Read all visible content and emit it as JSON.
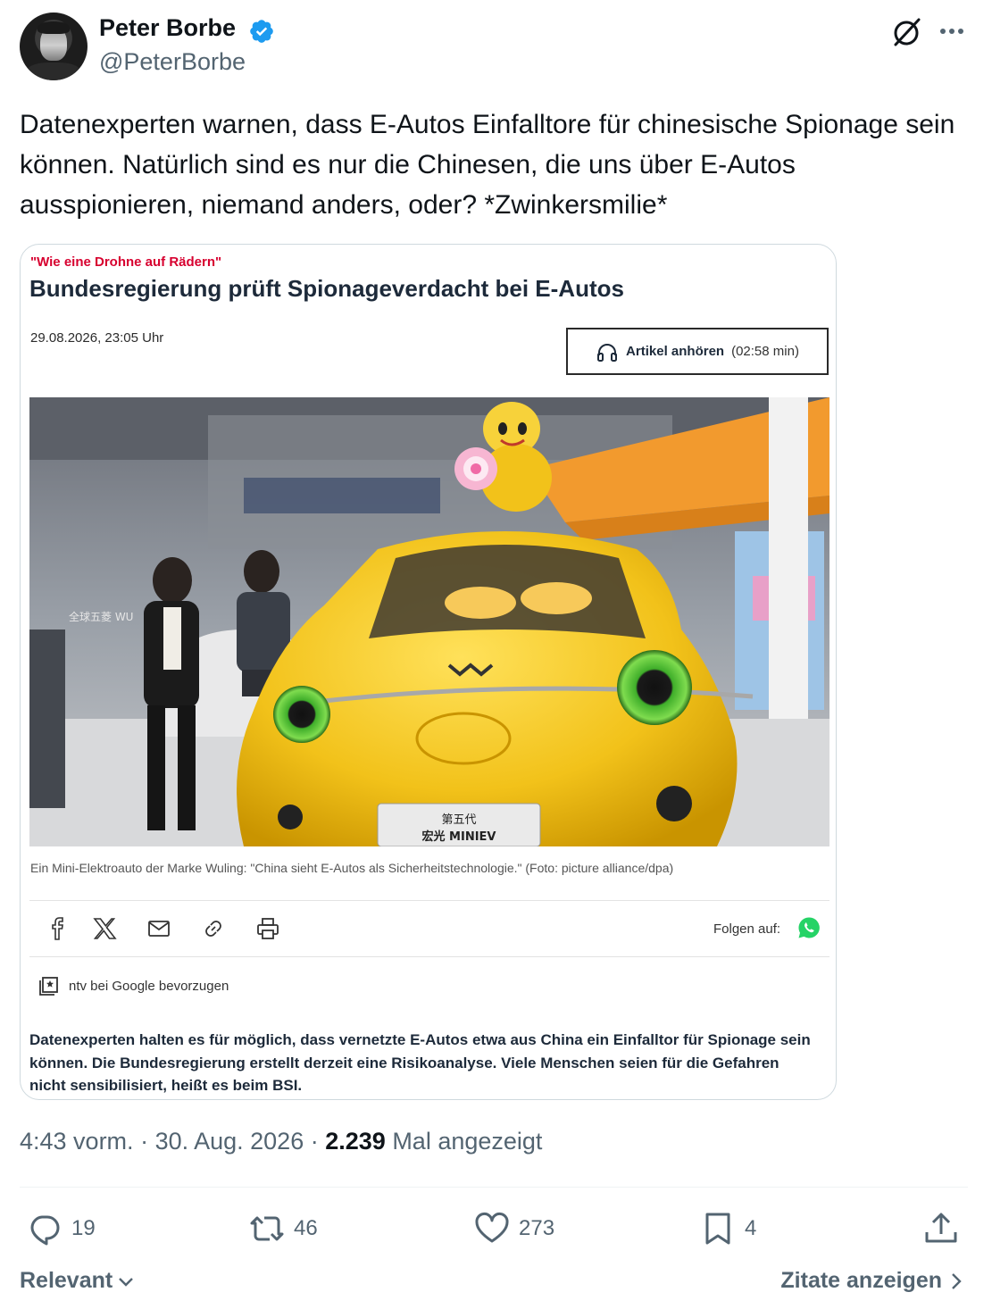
{
  "author": {
    "name": "Peter Borbe",
    "handle": "@PeterBorbe",
    "verified": true
  },
  "tweet": {
    "text": "Datenexperten warnen, dass E-Autos Einfalltore für chinesische Spionage sein können. Natürlich sind es nur die Chinesen, die uns über E-Autos ausspionieren, niemand anders, oder? *Zwinkersmilie*"
  },
  "article": {
    "kicker": "\"Wie eine Drohne auf Rädern\"",
    "headline": "Bundesregierung prüft Spionageverdacht bei E-Autos",
    "date": "29.08.2026, 23:05 Uhr",
    "listen_label": "Artikel anhören",
    "listen_duration": "(02:58 min)",
    "caption": "Ein Mini-Elektroauto der Marke Wuling: \"China sieht E-Autos als Sicherheitstechnologie.\" (Foto: picture alliance/dpa)",
    "follow_label": "Folgen auf:",
    "google_pref": "ntv bei Google bevorzugen",
    "teaser": "Datenexperten halten es für möglich, dass vernetzte E-Autos etwa aus China ein Einfalltor für Spionage sein können. Die Bundesregierung erstellt derzeit eine Risikoanalyse. Viele Menschen seien für die Gefahren nicht sensibilisiert, heißt es beim BSI.",
    "photo_plate_top": "第五代",
    "photo_plate_bottom": "宏光 MINIEV",
    "photo_sign": "全球五菱 WU"
  },
  "meta": {
    "time": "4:43 vorm.",
    "date": "30. Aug. 2026",
    "views": "2.239",
    "views_label": "Mal angezeigt"
  },
  "actions": {
    "replies": "19",
    "reposts": "46",
    "likes": "273",
    "bookmarks": "4"
  },
  "footer": {
    "sort_label": "Relevant",
    "quotes_label": "Zitate anzeigen"
  },
  "colors": {
    "accent_blue": "#1d9bf0",
    "text_primary": "#0f1419",
    "text_secondary": "#536471",
    "ntv_red": "#d7002f",
    "car_yellow": "#f2c21a"
  },
  "icons": [
    "verified-badge-icon",
    "grok-icon",
    "more-icon",
    "headphones-icon",
    "facebook-icon",
    "x-icon",
    "mail-icon",
    "link-icon",
    "print-icon",
    "whatsapp-icon",
    "bookmark-plus-icon",
    "reply-icon",
    "repost-icon",
    "like-icon",
    "bookmark-icon",
    "share-icon",
    "chevron-down-icon",
    "chevron-right-icon"
  ]
}
